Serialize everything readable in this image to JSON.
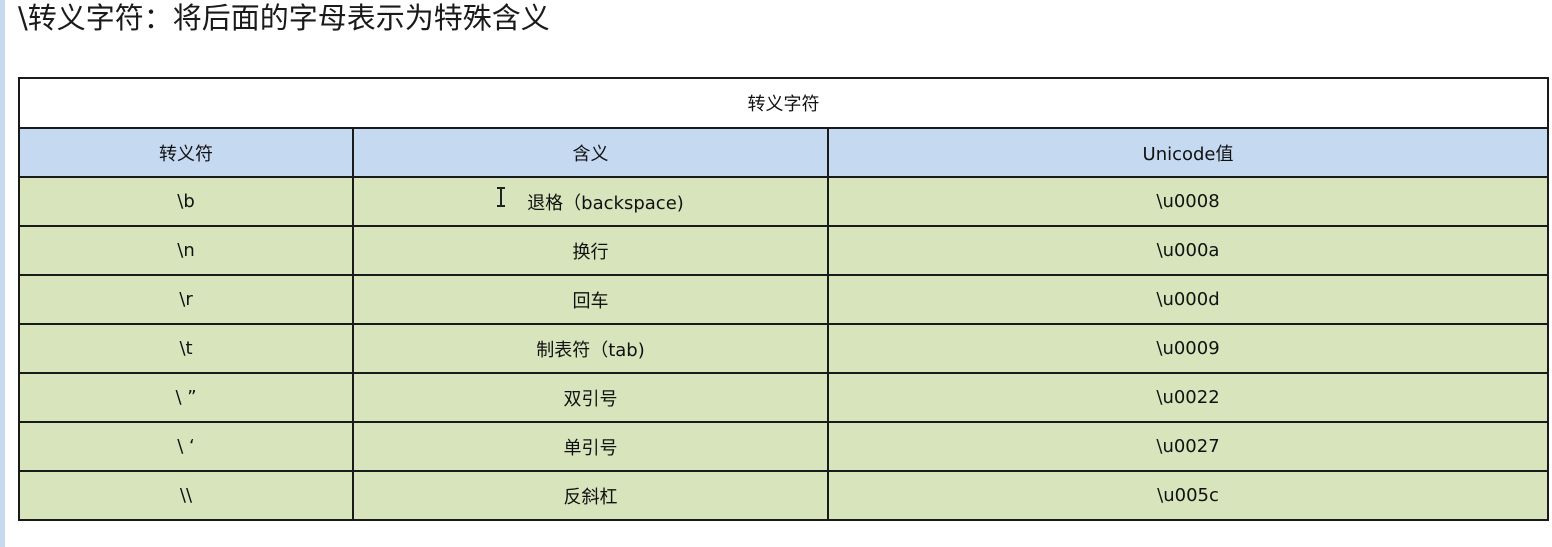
{
  "heading": "\\转义字符：将后面的字母表示为特殊含义",
  "table": {
    "caption": "转义字符",
    "headers": [
      "转义符",
      "含义",
      "Unicode值"
    ],
    "rows": [
      {
        "escape": "\\b",
        "meaning": "退格（backspace)",
        "unicode": "\\u0008"
      },
      {
        "escape": "\\n",
        "meaning": "换行",
        "unicode": "\\u000a"
      },
      {
        "escape": "\\r",
        "meaning": "回车",
        "unicode": "\\u000d"
      },
      {
        "escape": "\\t",
        "meaning": "制表符（tab)",
        "unicode": "\\u0009"
      },
      {
        "escape": "\\ ”",
        "meaning": "双引号",
        "unicode": "\\u0022"
      },
      {
        "escape": "\\ ‘",
        "meaning": "单引号",
        "unicode": "\\u0027"
      },
      {
        "escape": "\\\\",
        "meaning": "反斜杠",
        "unicode": "\\u005c"
      }
    ]
  },
  "icons": {
    "cursor": "text-cursor-icon"
  },
  "colors": {
    "header_bg": "#c5d9f1",
    "row_bg": "#d8e4bc",
    "border": "#1a1a1a"
  }
}
